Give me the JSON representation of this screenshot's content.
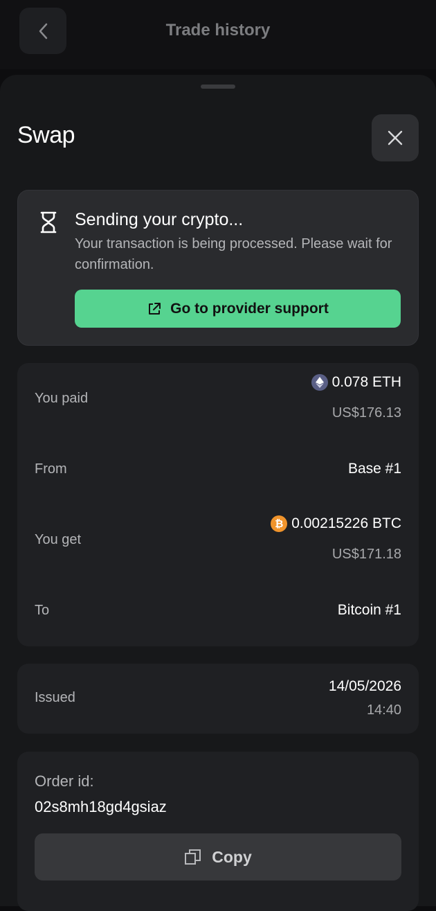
{
  "header": {
    "title": "Trade history"
  },
  "sheet": {
    "title": "Swap"
  },
  "status": {
    "title": "Sending your crypto...",
    "description": "Your transaction is being processed. Please wait for confirmation.",
    "support_label": "Go to provider support"
  },
  "details": {
    "paid_label": "You paid",
    "paid_amount": "0.078 ETH",
    "paid_fiat": "US$176.13",
    "from_label": "From",
    "from_value": "Base #1",
    "get_label": "You get",
    "get_amount": "0.00215226 BTC",
    "get_fiat": "US$171.18",
    "to_label": "To",
    "to_value": "Bitcoin #1"
  },
  "issued": {
    "label": "Issued",
    "date": "14/05/2026",
    "time": "14:40"
  },
  "order": {
    "label": "Order id:",
    "value": "02s8mh18gd4gsiaz",
    "copy_label": "Copy"
  },
  "icons": {
    "eth": "ethereum-icon",
    "btc": "bitcoin-icon"
  },
  "colors": {
    "accent": "#56d390",
    "eth": "#5a5f86",
    "btc": "#f0942c"
  }
}
